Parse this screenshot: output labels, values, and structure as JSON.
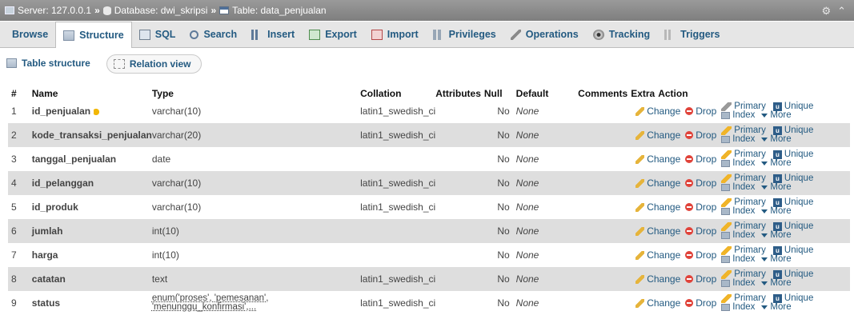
{
  "breadcrumb": {
    "server": "Server: 127.0.0.1",
    "database": "Database: dwi_skripsi",
    "table": "Table: data_penjualan",
    "separator": "»"
  },
  "tabs": [
    {
      "label": "Browse",
      "icon": "browse-icon"
    },
    {
      "label": "Structure",
      "icon": "structure-icon",
      "active": true
    },
    {
      "label": "SQL",
      "icon": "sql-icon"
    },
    {
      "label": "Search",
      "icon": "search-icon"
    },
    {
      "label": "Insert",
      "icon": "insert-icon"
    },
    {
      "label": "Export",
      "icon": "export-icon"
    },
    {
      "label": "Import",
      "icon": "import-icon"
    },
    {
      "label": "Privileges",
      "icon": "privileges-icon"
    },
    {
      "label": "Operations",
      "icon": "operations-icon"
    },
    {
      "label": "Tracking",
      "icon": "tracking-icon"
    },
    {
      "label": "Triggers",
      "icon": "triggers-icon"
    }
  ],
  "subtabs": {
    "table_structure": "Table structure",
    "relation_view": "Relation view"
  },
  "columns": {
    "num": "#",
    "name": "Name",
    "type": "Type",
    "collation": "Collation",
    "attributes": "Attributes",
    "null": "Null",
    "default": "Default",
    "comments": "Comments",
    "extra": "Extra",
    "action": "Action"
  },
  "actions": {
    "change": "Change",
    "drop": "Drop",
    "primary": "Primary",
    "unique": "Unique",
    "index": "Index",
    "more": "More"
  },
  "rows": [
    {
      "num": "1",
      "name": "id_penjualan",
      "key": true,
      "type": "varchar(10)",
      "collation": "latin1_swedish_ci",
      "null": "No",
      "default": "None"
    },
    {
      "num": "2",
      "name": "kode_transaksi_penjualan",
      "type": "varchar(20)",
      "collation": "latin1_swedish_ci",
      "null": "No",
      "default": "None"
    },
    {
      "num": "3",
      "name": "tanggal_penjualan",
      "type": "date",
      "collation": "",
      "null": "No",
      "default": "None"
    },
    {
      "num": "4",
      "name": "id_pelanggan",
      "type": "varchar(10)",
      "collation": "latin1_swedish_ci",
      "null": "No",
      "default": "None"
    },
    {
      "num": "5",
      "name": "id_produk",
      "type": "varchar(10)",
      "collation": "latin1_swedish_ci",
      "null": "No",
      "default": "None"
    },
    {
      "num": "6",
      "name": "jumlah",
      "type": "int(10)",
      "collation": "",
      "null": "No",
      "default": "None"
    },
    {
      "num": "7",
      "name": "harga",
      "type": "int(10)",
      "collation": "",
      "null": "No",
      "default": "None"
    },
    {
      "num": "8",
      "name": "catatan",
      "type": "text",
      "collation": "latin1_swedish_ci",
      "null": "No",
      "default": "None"
    },
    {
      "num": "9",
      "name": "status",
      "type_line1": "enum('proses', 'pemesanan',",
      "type_line2": "'menunggu_konfirmasi',...",
      "collation": "latin1_swedish_ci",
      "null": "No",
      "default": "None"
    }
  ]
}
